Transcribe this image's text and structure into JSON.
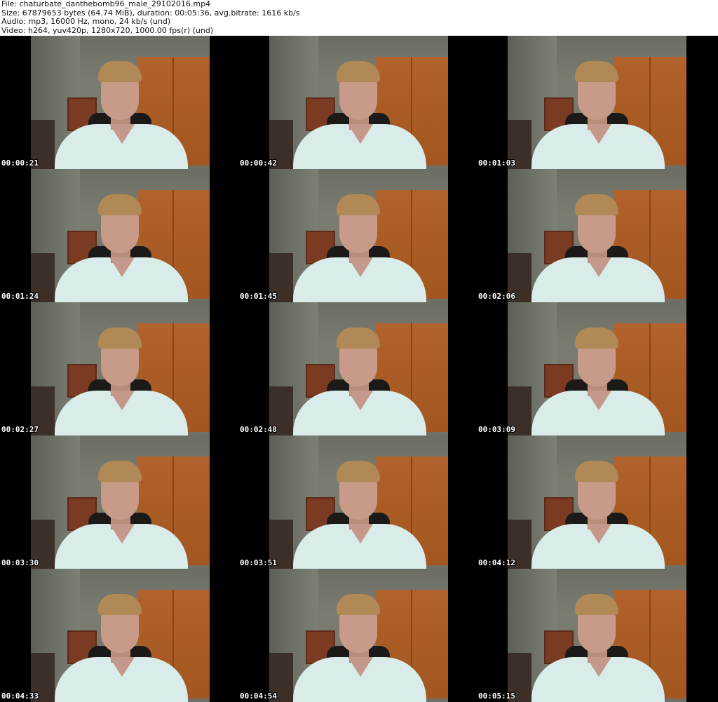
{
  "header": {
    "file": "File: chaturbate_danthebomb96_male_29102016.mp4",
    "size": "Size: 67879653 bytes (64.74 MiB), duration: 00:05:36, avg.bitrate: 1616 kb/s",
    "audio": "Audio: mp3, 16000 Hz, mono, 24 kb/s (und)",
    "video": "Video: h264, yuv420p, 1280x720, 1000.00 fps(r) (und)"
  },
  "thumbnails": [
    "00:00:21",
    "00:00:42",
    "00:01:03",
    "00:01:24",
    "00:01:45",
    "00:02:06",
    "00:02:27",
    "00:02:48",
    "00:03:09",
    "00:03:30",
    "00:03:51",
    "00:04:12",
    "00:04:33",
    "00:04:54",
    "00:05:15"
  ]
}
